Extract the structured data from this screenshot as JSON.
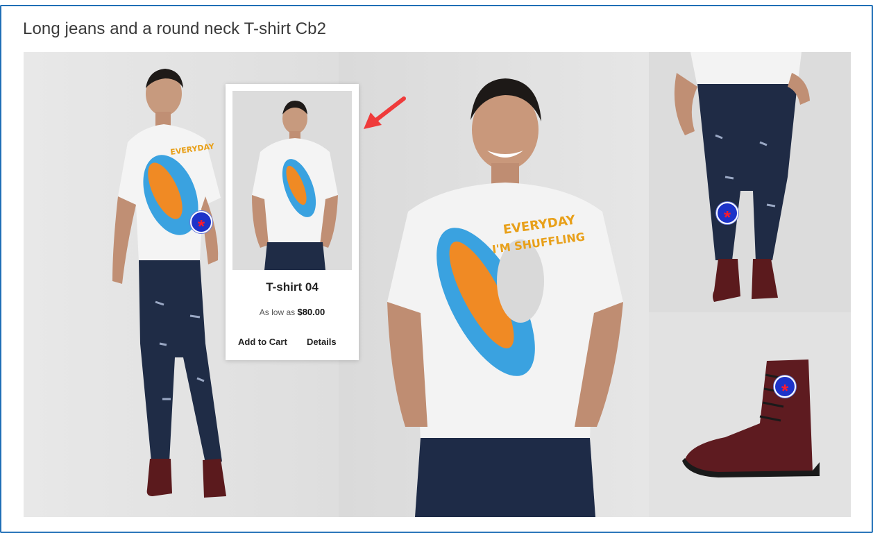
{
  "page": {
    "title": "Long jeans and a round neck T-shirt Cb2"
  },
  "hotspots": [
    {
      "symbol": "*"
    },
    {
      "symbol": "*"
    },
    {
      "symbol": "*"
    }
  ],
  "popup": {
    "product_name": "T-shirt 04",
    "price_prefix": "As low as",
    "price": "$80.00",
    "add_to_cart_label": "Add to Cart",
    "details_label": "Details"
  },
  "shirt_print": {
    "line1": "EVERYDAY",
    "line2": "I'M SHUFFLING"
  },
  "colors": {
    "frame_border": "#1f6fb6",
    "hotspot_fill": "#1d33c9",
    "hotspot_star": "#ff1b2d",
    "arrow": "#ef3b3b"
  }
}
